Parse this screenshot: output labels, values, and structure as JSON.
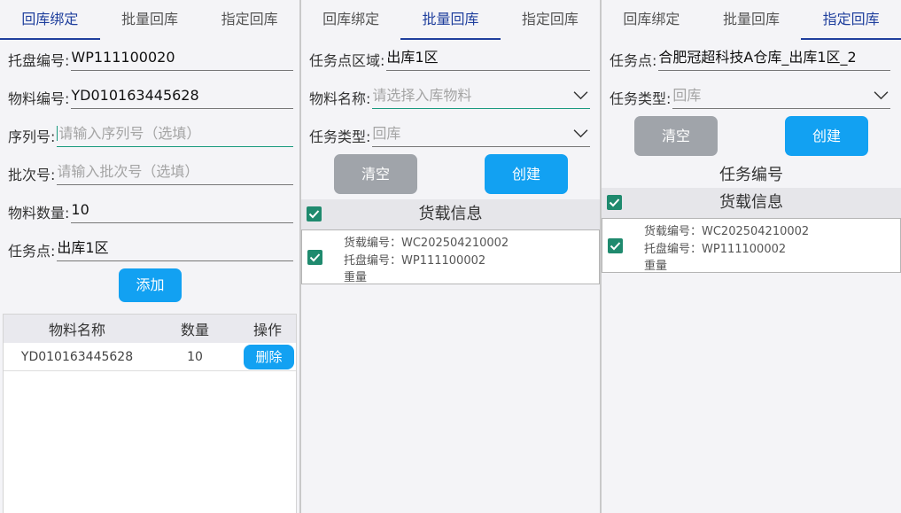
{
  "panels": [
    {
      "tabs": [
        "回库绑定",
        "批量回库",
        "指定回库"
      ],
      "active_tab": 0,
      "fields": [
        {
          "label": "托盘编号:",
          "value": "WP111100020"
        },
        {
          "label": "物料编号:",
          "value": "YD010163445628"
        },
        {
          "label": "序列号:",
          "placeholder": "请输入序列号（选填）"
        },
        {
          "label": "批次号:",
          "placeholder": "请输入批次号（选填）"
        },
        {
          "label": "物料数量:",
          "value": "10"
        },
        {
          "label": "任务点:",
          "value": "出库1区"
        }
      ],
      "add_button": "添加",
      "table": {
        "headers": [
          "物料名称",
          "数量",
          "操作"
        ],
        "rows": [
          {
            "name": "YD010163445628",
            "qty": "10",
            "action": "删除"
          }
        ]
      }
    },
    {
      "tabs": [
        "回库绑定",
        "批量回库",
        "指定回库"
      ],
      "active_tab": 1,
      "fields": [
        {
          "label": "任务点区域:",
          "value": "出库1区"
        },
        {
          "label": "物料名称:",
          "placeholder": "请选择入库物料"
        },
        {
          "label": "任务类型:",
          "placeholder": "回库"
        }
      ],
      "clear_button": "清空",
      "create_button": "创建",
      "section_title": "货载信息",
      "card": {
        "lines": [
          "货载编号：WC202504210002",
          "托盘编号：WP111100002",
          "重量"
        ]
      }
    },
    {
      "tabs": [
        "回库绑定",
        "批量回库",
        "指定回库"
      ],
      "active_tab": 2,
      "fields": [
        {
          "label": "任务点:",
          "value": "合肥冠超科技A仓库_出库1区_2"
        },
        {
          "label": "任务类型:",
          "placeholder": "回库"
        }
      ],
      "clear_button": "清空",
      "create_button": "创建",
      "task_number_label": "任务编号",
      "section_title": "货载信息",
      "card": {
        "lines": [
          "货载编号：WC202504210002",
          "托盘编号：WP111100002",
          "重量"
        ]
      }
    }
  ],
  "colors": {
    "accent_tab": "#1f3f9d",
    "button_blue": "#12a1f2",
    "button_gray": "#a0a4aa",
    "checkbox": "#1f8a6e",
    "focus_line": "#1a9a7e"
  },
  "icons": {
    "dropdown": "chevron-down-icon",
    "checkbox": "checkbox-checked-icon"
  }
}
